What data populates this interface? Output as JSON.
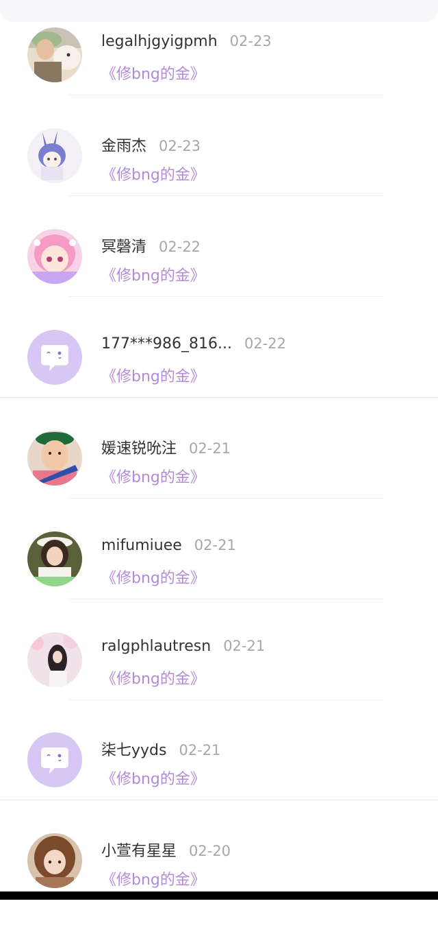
{
  "items": [
    {
      "name": "legalhjgyigpmh",
      "date": "02-23",
      "title": "《修bng的金》",
      "avatar": "photo-man-dog"
    },
    {
      "name": "金雨杰",
      "date": "02-23",
      "title": "《修bng的金》",
      "avatar": "anime-bunny-girl"
    },
    {
      "name": "冥磬清",
      "date": "02-22",
      "title": "《修bng的金》",
      "avatar": "anime-pink-girl"
    },
    {
      "name": "177***986_816...",
      "date": "02-22",
      "title": "《修bng的金》",
      "avatar": "default-chat"
    },
    {
      "name": "媛速锐吮注",
      "date": "02-21",
      "title": "《修bng的金》",
      "avatar": "photo-boy-cap"
    },
    {
      "name": "mifumiuee",
      "date": "02-21",
      "title": "《修bng的金》",
      "avatar": "photo-girl-flowers"
    },
    {
      "name": "ralgphlautresn",
      "date": "02-21",
      "title": "《修bng的金》",
      "avatar": "photo-girl-blossom"
    },
    {
      "name": "柒七yyds",
      "date": "02-21",
      "title": "《修bng的金》",
      "avatar": "default-chat"
    },
    {
      "name": "小萱有星星",
      "date": "02-20",
      "title": "《修bng的金》",
      "avatar": "anime-brown-hair"
    }
  ],
  "colors": {
    "accent_title": "#b38ad8",
    "name_text": "#333333",
    "date_text": "#a7a7a7",
    "default_avatar_bg": "#d7c7f4"
  }
}
